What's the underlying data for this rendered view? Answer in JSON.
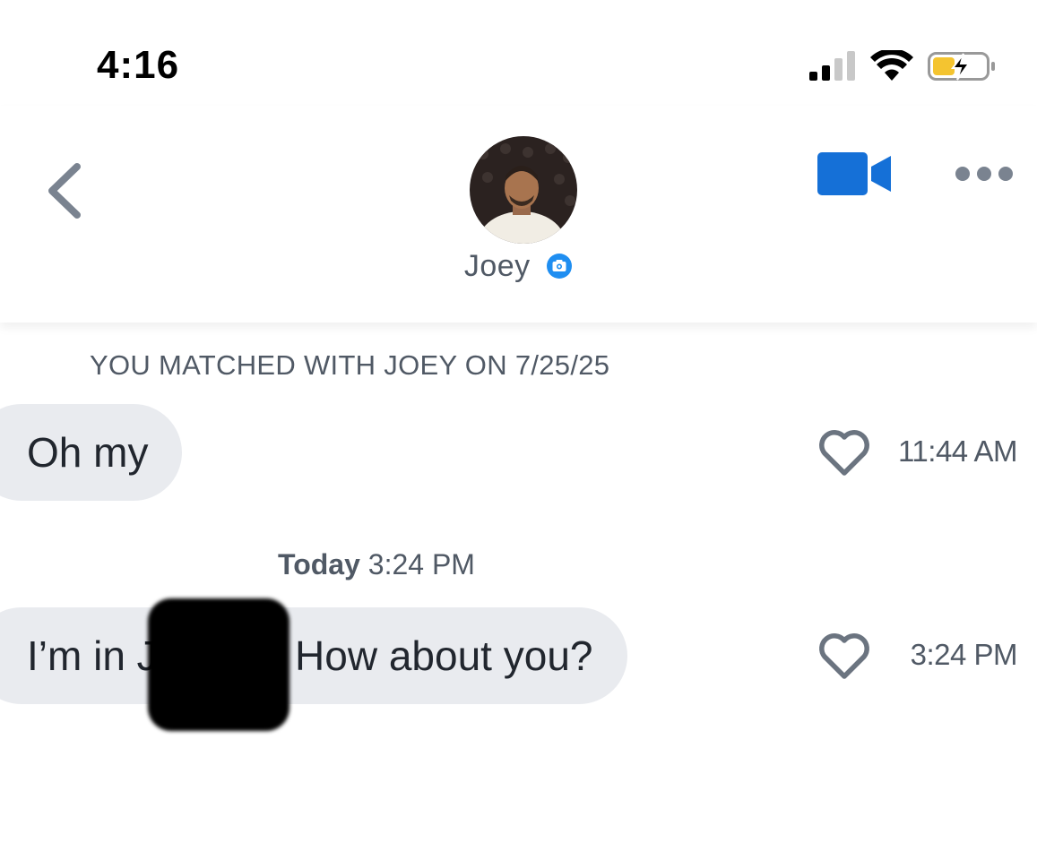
{
  "status_bar": {
    "time": "4:16",
    "icons": [
      "cellular-signal-icon",
      "wifi-icon",
      "battery-charging-icon"
    ],
    "battery_color": "#f4c430"
  },
  "header": {
    "contact_name": "Joey",
    "avatar": "profile-photo",
    "verified_badge": "camera-verified-icon",
    "accent_color": "#1570d7"
  },
  "conversation": {
    "match_banner": "YOU MATCHED WITH JOEY ON 7/25/25",
    "messages": [
      {
        "text": "Oh my",
        "time": "11:44 AM",
        "liked": false
      },
      {
        "text": "I’m in J          . How about you?",
        "time": "3:24 PM",
        "liked": false
      }
    ],
    "day_separator": {
      "day": "Today",
      "time": "3:24 PM"
    }
  }
}
